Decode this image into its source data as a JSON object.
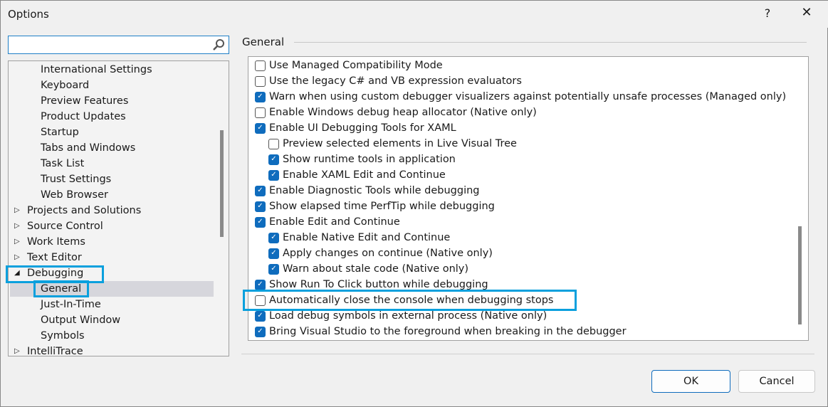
{
  "window": {
    "title": "Options",
    "help_label": "?",
    "close_label": "✕"
  },
  "search": {
    "value": "",
    "placeholder": ""
  },
  "tree": [
    {
      "label": "International Settings",
      "level": 1
    },
    {
      "label": "Keyboard",
      "level": 1
    },
    {
      "label": "Preview Features",
      "level": 1
    },
    {
      "label": "Product Updates",
      "level": 1
    },
    {
      "label": "Startup",
      "level": 1
    },
    {
      "label": "Tabs and Windows",
      "level": 1
    },
    {
      "label": "Task List",
      "level": 1
    },
    {
      "label": "Trust Settings",
      "level": 1
    },
    {
      "label": "Web Browser",
      "level": 1
    },
    {
      "label": "Projects and Solutions",
      "level": 0,
      "expander": "collapsed"
    },
    {
      "label": "Source Control",
      "level": 0,
      "expander": "collapsed"
    },
    {
      "label": "Work Items",
      "level": 0,
      "expander": "collapsed"
    },
    {
      "label": "Text Editor",
      "level": 0,
      "expander": "collapsed"
    },
    {
      "label": "Debugging",
      "level": 0,
      "expander": "expanded"
    },
    {
      "label": "General",
      "level": 1,
      "selected": true
    },
    {
      "label": "Just-In-Time",
      "level": 1
    },
    {
      "label": "Output Window",
      "level": 1
    },
    {
      "label": "Symbols",
      "level": 1
    },
    {
      "label": "IntelliTrace",
      "level": 0,
      "expander": "collapsed"
    }
  ],
  "group_label": "General",
  "options": [
    {
      "label": "Use Managed Compatibility Mode",
      "checked": false,
      "level": 0
    },
    {
      "label": "Use the legacy C# and VB expression evaluators",
      "checked": false,
      "level": 0
    },
    {
      "label": "Warn when using custom debugger visualizers against potentially unsafe processes (Managed only)",
      "checked": true,
      "level": 0
    },
    {
      "label": "Enable Windows debug heap allocator (Native only)",
      "checked": false,
      "level": 0
    },
    {
      "label": "Enable UI Debugging Tools for XAML",
      "checked": true,
      "level": 0
    },
    {
      "label": "Preview selected elements in Live Visual Tree",
      "checked": false,
      "level": 1
    },
    {
      "label": "Show runtime tools in application",
      "checked": true,
      "level": 1
    },
    {
      "label": "Enable XAML Edit and Continue",
      "checked": true,
      "level": 1
    },
    {
      "label": "Enable Diagnostic Tools while debugging",
      "checked": true,
      "level": 0
    },
    {
      "label": "Show elapsed time PerfTip while debugging",
      "checked": true,
      "level": 0
    },
    {
      "label": "Enable Edit and Continue",
      "checked": true,
      "level": 0
    },
    {
      "label": "Enable Native Edit and Continue",
      "checked": true,
      "level": 1
    },
    {
      "label": "Apply changes on continue (Native only)",
      "checked": true,
      "level": 1
    },
    {
      "label": "Warn about stale code (Native only)",
      "checked": true,
      "level": 1
    },
    {
      "label": "Show Run To Click button while debugging",
      "checked": true,
      "level": 0
    },
    {
      "label": "Automatically close the console when debugging stops",
      "checked": false,
      "level": 0
    },
    {
      "label": "Load debug symbols in external process (Native only)",
      "checked": true,
      "level": 0
    },
    {
      "label": "Bring Visual Studio to the foreground when breaking in the debugger",
      "checked": true,
      "level": 0
    }
  ],
  "buttons": {
    "ok": "OK",
    "cancel": "Cancel"
  },
  "colors": {
    "accent": "#0f6cbd",
    "highlight": "#0aa0dd"
  }
}
